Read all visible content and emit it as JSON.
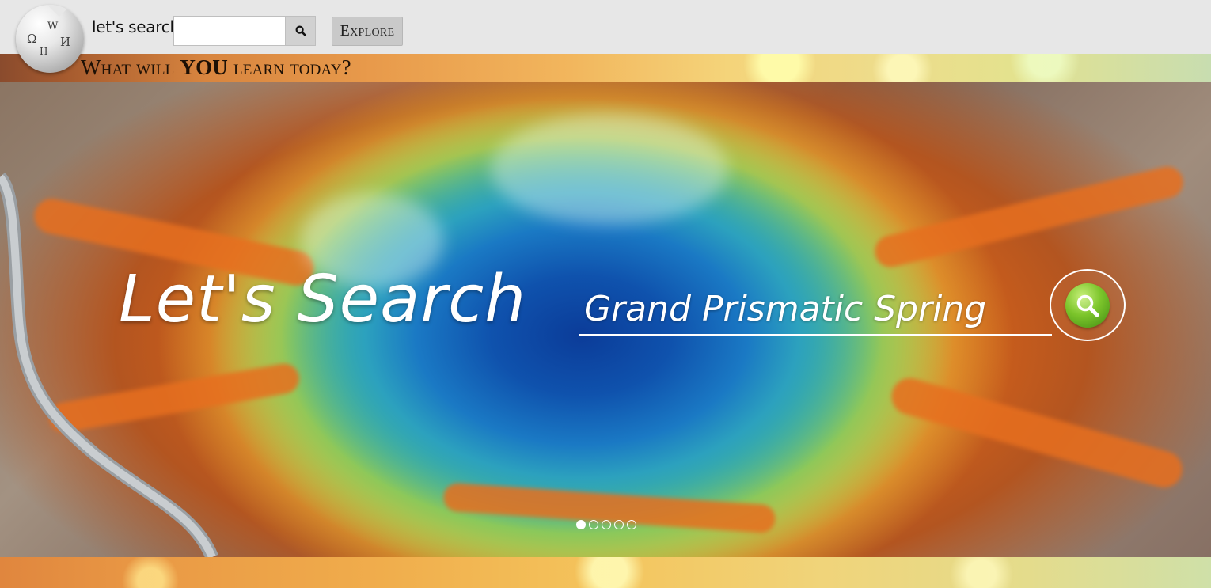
{
  "header": {
    "brand_label": "let's search",
    "search": {
      "value": "",
      "placeholder": ""
    },
    "search_button_icon": "search-icon",
    "explore_label": "Explore",
    "logo_icon": "wikipedia-globe-logo"
  },
  "banner": {
    "tagline_before": "What will ",
    "tagline_emphasis": "YOU",
    "tagline_after": " learn today?"
  },
  "hero": {
    "title": "Let's Search",
    "search_value": "Grand Prismatic Spring",
    "search_button_icon": "magnifier-icon",
    "background_subject": "Grand Prismatic Spring aerial photo",
    "slides": [
      {
        "active": true
      },
      {
        "active": false
      },
      {
        "active": false
      },
      {
        "active": false
      },
      {
        "active": false
      }
    ]
  },
  "colors": {
    "topbar": "#e7e7e7",
    "explore_button": "#c9c9c9",
    "hero_text": "#ffffff",
    "search_ball": "#7cc52b"
  }
}
